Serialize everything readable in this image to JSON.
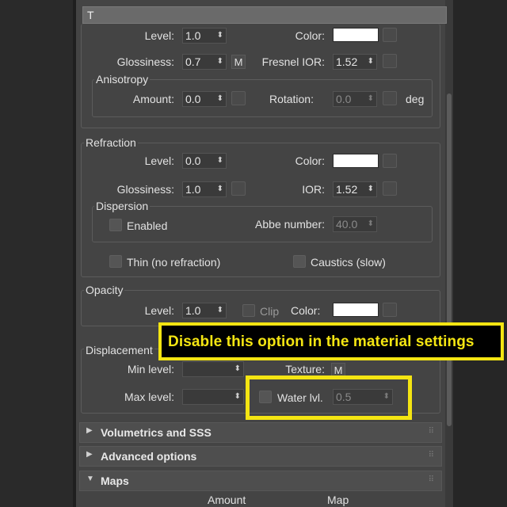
{
  "topbar": {
    "text": "T"
  },
  "reflection": {
    "level_label": "Level:",
    "level_value": "1.0",
    "color_label": "Color:",
    "glossiness_label": "Glossiness:",
    "glossiness_value": "0.7",
    "glossiness_map": "M",
    "fresnel_label": "Fresnel IOR:",
    "fresnel_value": "1.52",
    "anisotropy": {
      "title": "Anisotropy",
      "amount_label": "Amount:",
      "amount_value": "0.0",
      "rotation_label": "Rotation:",
      "rotation_value": "0.0",
      "rotation_unit": "deg"
    }
  },
  "refraction": {
    "title": "Refraction",
    "level_label": "Level:",
    "level_value": "0.0",
    "color_label": "Color:",
    "glossiness_label": "Glossiness:",
    "glossiness_value": "1.0",
    "ior_label": "IOR:",
    "ior_value": "1.52",
    "dispersion": {
      "title": "Dispersion",
      "enabled_label": "Enabled",
      "abbe_label": "Abbe number:",
      "abbe_value": "40.0"
    },
    "thin_label": "Thin (no refraction)",
    "caustics_label": "Caustics (slow)"
  },
  "opacity": {
    "title": "Opacity",
    "level_label": "Level:",
    "level_value": "1.0",
    "clip_label": "Clip",
    "color_label": "Color:"
  },
  "displacement": {
    "title": "Displacement",
    "min_label": "Min level:",
    "texture_label": "Texture:",
    "texture_map": "M",
    "max_label": "Max level:",
    "water_label": "Water lvl.",
    "water_value": "0.5"
  },
  "rollouts": [
    {
      "label": "Volumetrics and SSS",
      "state": "collapsed",
      "arrow": "▶"
    },
    {
      "label": "Advanced options",
      "state": "collapsed",
      "arrow": "▶"
    },
    {
      "label": "Maps",
      "state": "expanded",
      "arrow": "▼"
    }
  ],
  "maps": {
    "amount_header": "Amount",
    "map_header": "Map"
  },
  "callout": {
    "text": "Disable this option in the material settings"
  },
  "spinner_arrow": "⬍",
  "grip": "⠿",
  "colors": {
    "swatch": "#ffffff",
    "callout": "#f4e512",
    "panel": "#444444"
  }
}
